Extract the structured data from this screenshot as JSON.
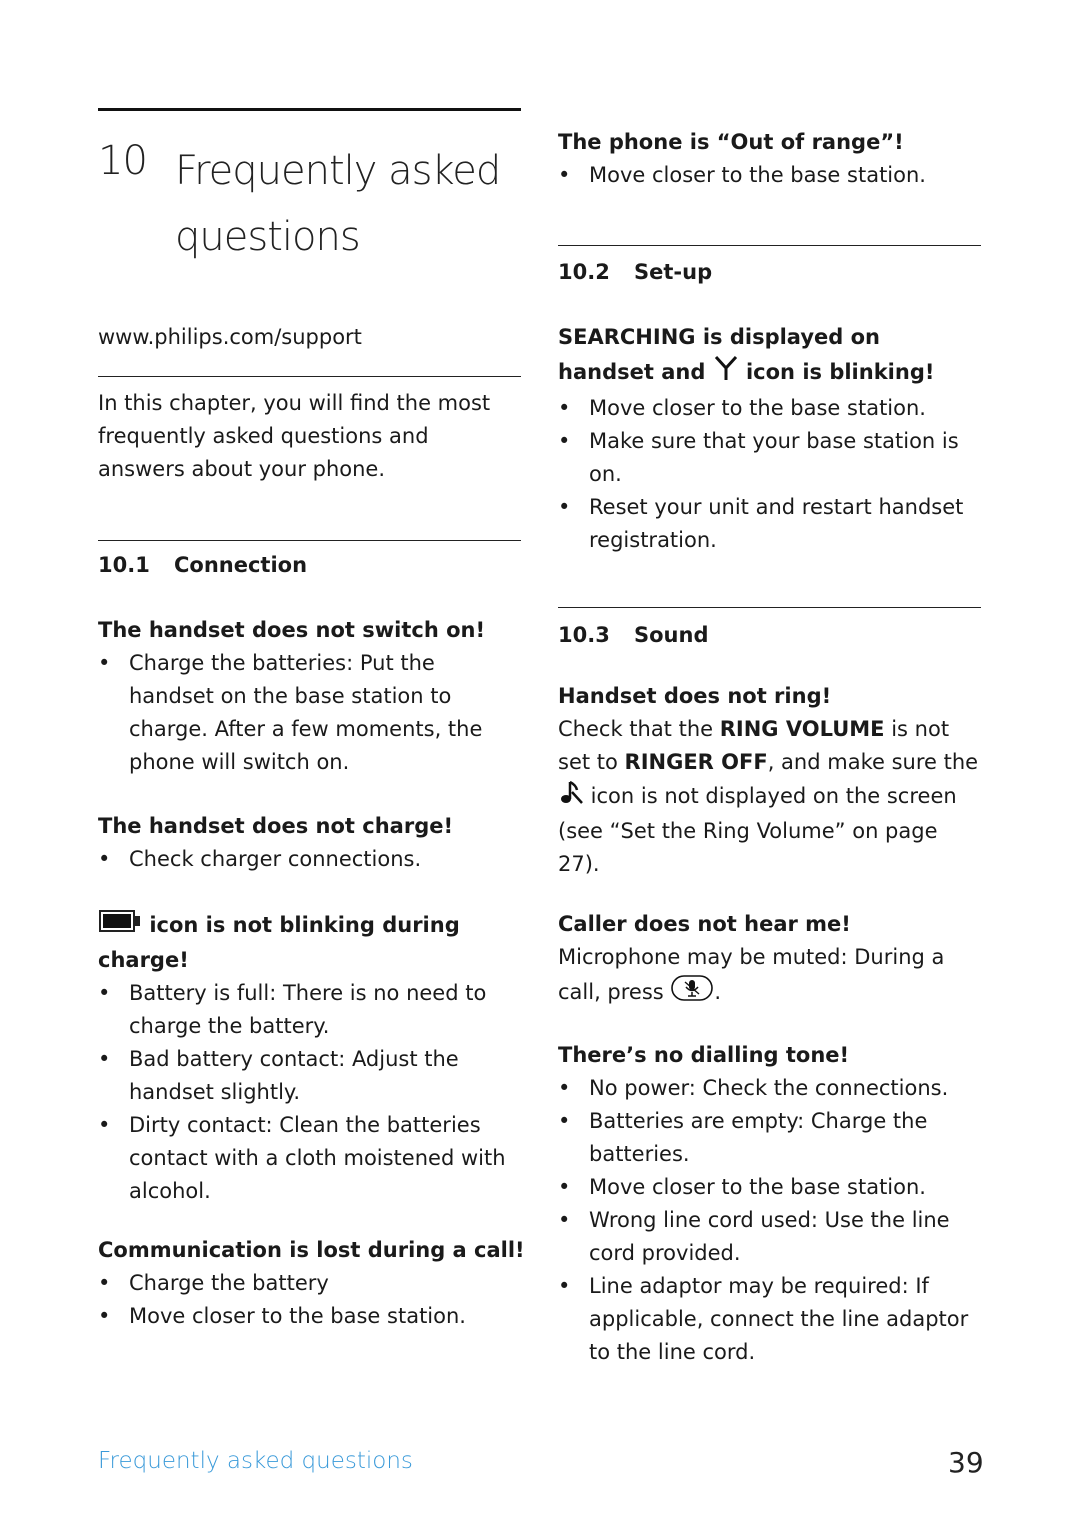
{
  "chapter": {
    "number": "10",
    "title": "Frequently asked questions",
    "url": "www.philips.com/support",
    "intro": "In this chapter, you will find the most frequently asked questions and answers about your phone."
  },
  "sections": {
    "connection": {
      "number": "10.1",
      "title": "Connection",
      "q1": {
        "title": "The handset does not switch on!",
        "bullets": [
          "Charge the batteries: Put the handset on the base station to charge. After a few moments, the phone will switch on."
        ]
      },
      "q2": {
        "title": "The handset does not charge!",
        "bullets": [
          "Check charger connections."
        ]
      },
      "q3": {
        "icon": "battery-icon",
        "title_after_icon": "icon is not blinking during charge!",
        "bullets": [
          "Battery is full: There is no need to charge the battery.",
          "Bad battery contact: Adjust the handset slightly.",
          "Dirty contact: Clean the batteries contact with a cloth moistened with alcohol."
        ]
      },
      "q4": {
        "title": "Communication is lost during a call!",
        "bullets": [
          "Charge the battery",
          "Move closer to the base station."
        ]
      },
      "q5": {
        "title": "The phone is “Out of range”!",
        "bullets": [
          "Move closer to the base station."
        ]
      }
    },
    "setup": {
      "number": "10.2",
      "title": "Set-up",
      "q1": {
        "title_keyword": "SEARCHING",
        "title_part1": " is displayed on handset and ",
        "icon": "antenna-icon",
        "title_part2": " icon is blinking!",
        "bullets": [
          "Move closer to the base station.",
          "Make sure that your base station is on.",
          "Reset your unit and restart handset registration."
        ]
      }
    },
    "sound": {
      "number": "10.3",
      "title": "Sound",
      "q1": {
        "title": "Handset does not ring!",
        "text_1": "Check that the ",
        "kw_1": "RING VOLUME",
        "text_2": " is not set to ",
        "kw_2": "RINGER OFF",
        "text_3": ", and make sure the ",
        "icon": "ringer-off-icon",
        "text_4": " icon is not displayed on the screen (see “Set the Ring Volume” on page 27)."
      },
      "q2": {
        "title": "Caller does not hear me!",
        "text_1": "Microphone may be muted: During a call, press ",
        "icon": "mute-button-icon",
        "text_2": "."
      },
      "q3": {
        "title": "There’s no dialling tone!",
        "bullets": [
          "No power: Check the connections.",
          "Batteries are empty: Charge the batteries.",
          "Move closer to the base station.",
          "Wrong line cord used: Use the line cord provided.",
          "Line adaptor may be required: If applicable, connect the line adaptor to the line cord."
        ]
      }
    }
  },
  "footer": {
    "section_name": "Frequently asked questions",
    "page_number": "39"
  },
  "colors": {
    "footer_accent": "#3a9ad9",
    "text": "#1a1a1a"
  }
}
